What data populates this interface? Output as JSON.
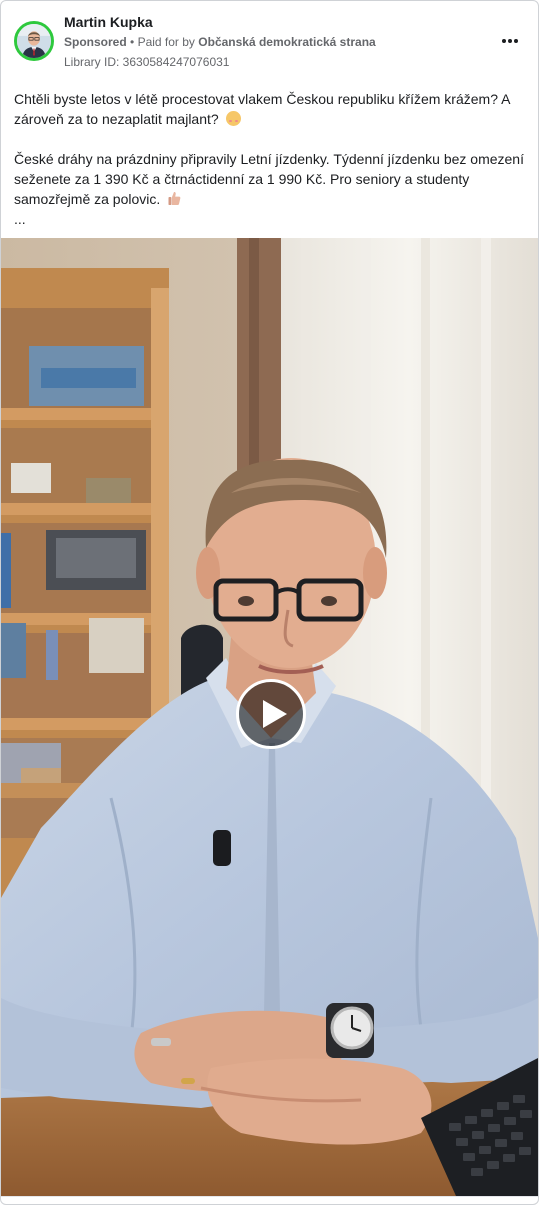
{
  "post": {
    "author_name": "Martin Kupka",
    "sponsored_label": "Sponsored",
    "paid_for_prefix": "Paid for by",
    "payer": "Občanská demokratická strana",
    "library_id": "Library ID: 3630584247076031",
    "more_icon": "more-horizontal-icon",
    "avatar_ring_color": "#2ec93d"
  },
  "text": {
    "paragraph_1": "Chtěli byste letos v létě procestovat vlakem Českou republiku křížem krážem? A zároveň za to nezaplatit majlant?",
    "paragraph_2": "České dráhy na prázdniny připravily Letní jízdenky. Týdenní jízdenku bez omezení seženete za 1 390 Kč a čtrnáctidenní za 1 990 Kč. Pro seniory a studenty samozřejmě za polovic.",
    "ellipsis": "...",
    "emoji_1": "blushing-face-emoji",
    "emoji_2": "thumbs-up-emoji"
  },
  "media": {
    "type": "video",
    "play_icon": "play-icon"
  }
}
